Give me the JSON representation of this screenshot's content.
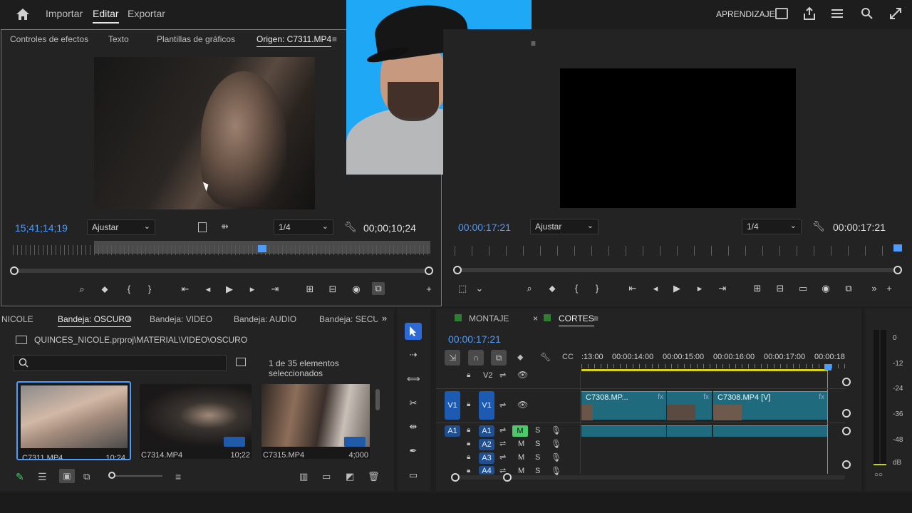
{
  "topbar": {
    "nav": [
      "Importar",
      "Editar",
      "Exportar"
    ],
    "active": "Editar",
    "learn_label": "APRENDIZAJE"
  },
  "source_panel": {
    "tabs": [
      "Controles de efectos",
      "Texto",
      "Plantillas de gráficos",
      "Origen: C7311.MP4"
    ],
    "active_tab": "Origen: C7311.MP4",
    "timecode_left": "15;41;14;19",
    "fit": "Ajustar",
    "quality": "1/4",
    "timecode_right": "00;00;10;24",
    "playhead_fraction": 0.59
  },
  "program_panel": {
    "timecode_left": "00:00:17:21",
    "fit": "Ajustar",
    "quality": "1/4",
    "timecode_right": "00:00:17:21",
    "playhead_fraction": 1.0
  },
  "project_panel": {
    "tabs": [
      "NICOLE",
      "Bandeja: OSCURO",
      "Bandeja: VIDEO",
      "Bandeja: AUDIO",
      "Bandeja: SECUEN"
    ],
    "active_tab": "Bandeja: OSCURO",
    "path": "QUINCES_NICOLE.prproj\\MATERIAL\\VIDEO\\OSCURO",
    "search_placeholder": "",
    "selection_info": "1 de 35 elementos seleccionados",
    "thumbnails": [
      {
        "name": "C7311.MP4",
        "duration": "10;24"
      },
      {
        "name": "C7314.MP4",
        "duration": "10;22"
      },
      {
        "name": "C7315.MP4",
        "duration": "4;000"
      }
    ]
  },
  "timeline": {
    "tabs": [
      "MONTAJE",
      "CORTES"
    ],
    "active_tab": "CORTES",
    "timecode": "00:00:17:21",
    "ruler_labels": [
      ":13:00",
      "00:00:14:00",
      "00:00:15:00",
      "00:00:16:00",
      "00:00:17:00",
      "00:00:18"
    ],
    "tracks": {
      "video": [
        "V2",
        "V1"
      ],
      "audio": [
        "A1",
        "A2",
        "A3",
        "A4"
      ],
      "mute": "M",
      "solo": "S"
    },
    "clips": [
      {
        "label": "C7308.MP..."
      },
      {
        "label": ""
      },
      {
        "label": "C7308.MP4 [V]"
      }
    ]
  },
  "meter": {
    "labels": [
      "0",
      "-12",
      "-24",
      "-36",
      "-48",
      "dB"
    ]
  },
  "icons": {
    "home": "home-icon",
    "wrench": "wrench-icon",
    "play": "play-icon",
    "camera": "camera-icon",
    "search": "search-icon"
  },
  "colors": {
    "accent_blue": "#2d8ceb",
    "clip_teal": "#1f6b7d",
    "timecode_blue": "#4c9bff",
    "webcam_bg": "#1ea8f5"
  }
}
